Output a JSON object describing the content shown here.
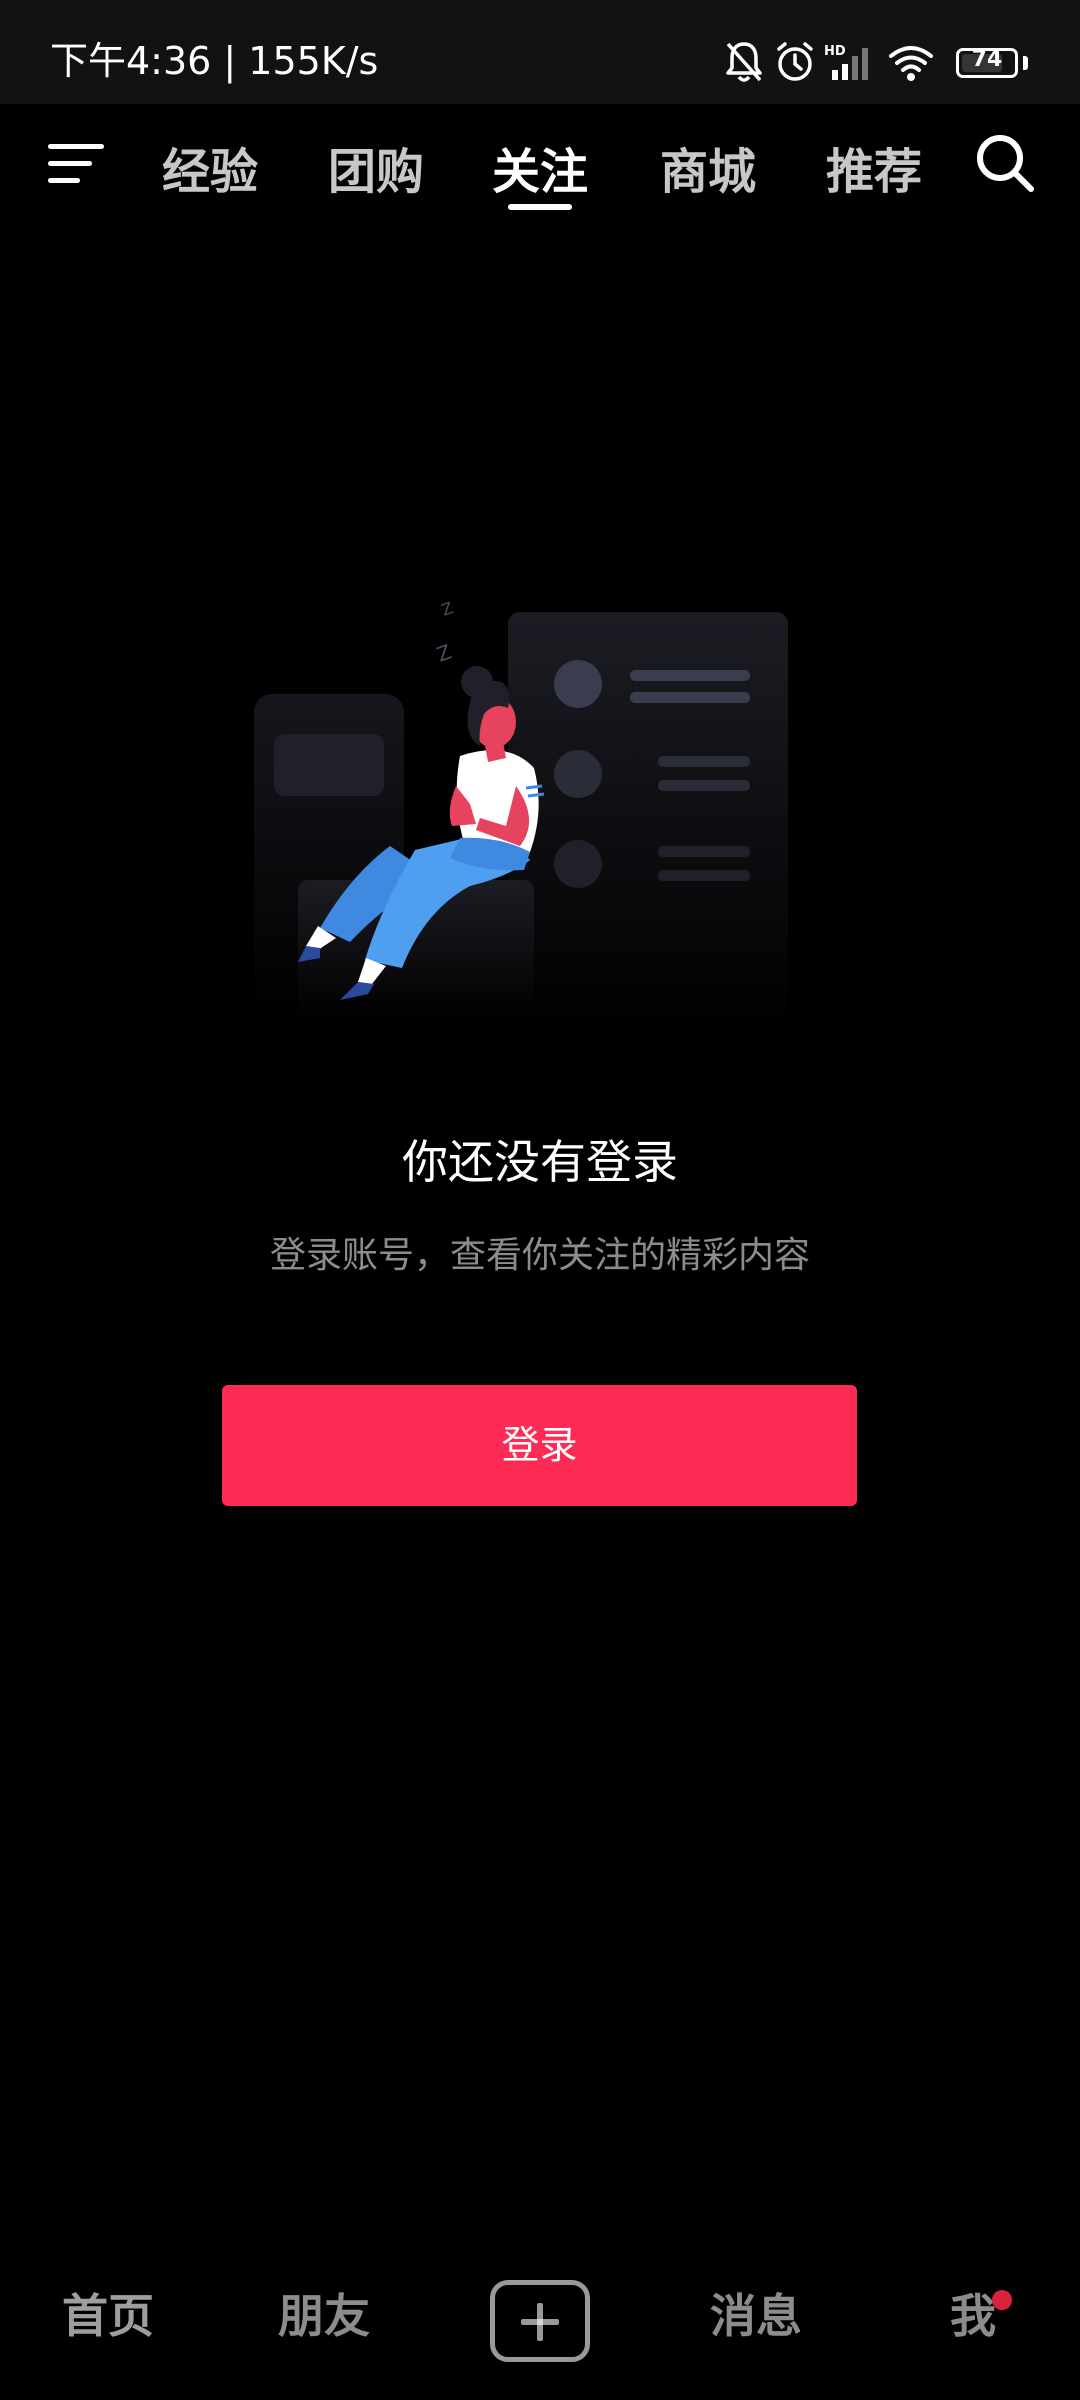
{
  "status_bar": {
    "time_speed": "下午4:36 | 155K/s",
    "battery_level": "74",
    "icons": [
      "mute-icon",
      "alarm-icon",
      "signal-icon",
      "wifi-icon",
      "battery-icon"
    ]
  },
  "top_nav": {
    "tabs": [
      {
        "label": "经验"
      },
      {
        "label": "团购"
      },
      {
        "label": "关注"
      },
      {
        "label": "商城"
      },
      {
        "label": "推荐"
      }
    ],
    "active_tab": "关注"
  },
  "empty_state": {
    "title": "你还没有登录",
    "subtitle": "登录账号，查看你关注的精彩内容",
    "login_label": "登录"
  },
  "bottom_nav": {
    "items": [
      {
        "label": "首页"
      },
      {
        "label": "朋友"
      },
      {
        "label": "消息"
      },
      {
        "label": "我"
      }
    ]
  },
  "colors": {
    "accent": "#fe2c55",
    "background": "#000000",
    "notify_dot": "#d8223e"
  }
}
